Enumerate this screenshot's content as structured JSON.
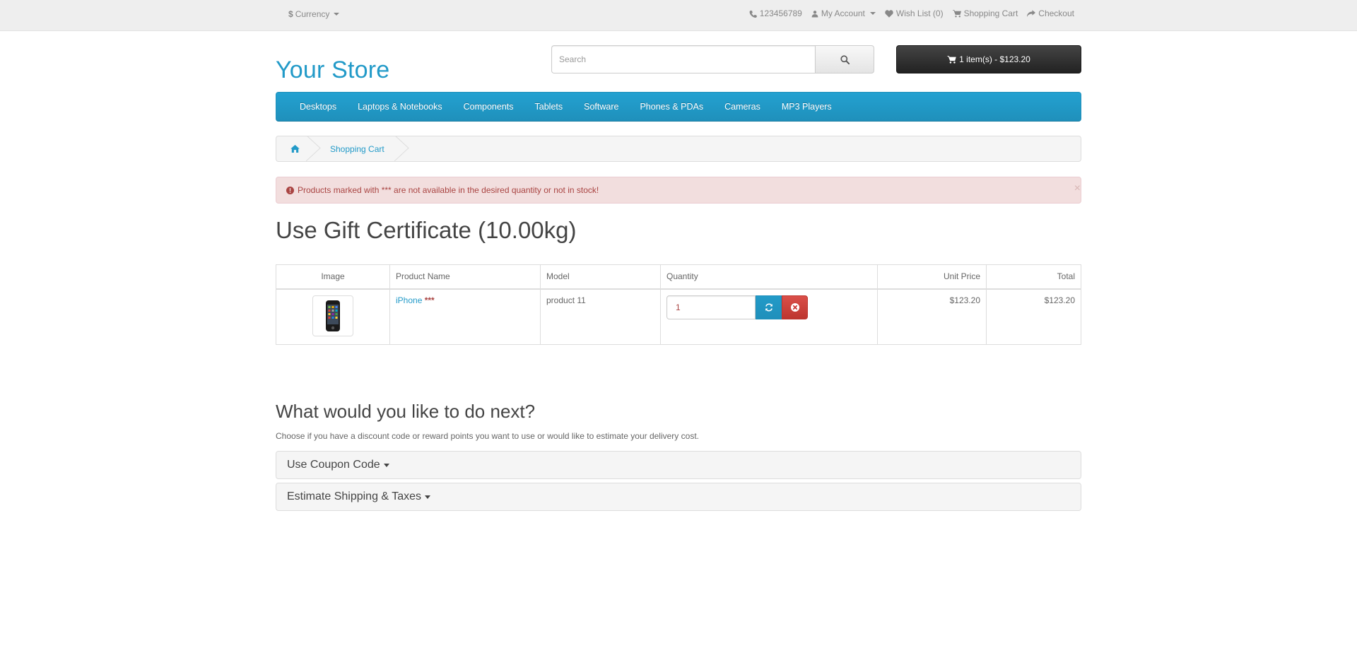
{
  "topbar": {
    "currency_label": "Currency",
    "phone": "123456789",
    "my_account": "My Account",
    "wishlist": "Wish List (0)",
    "shopping_cart": "Shopping Cart",
    "checkout": "Checkout"
  },
  "header": {
    "logo": "Your Store",
    "search_placeholder": "Search",
    "cart_button": "1 item(s) - $123.20"
  },
  "menu": [
    "Desktops",
    "Laptops & Notebooks",
    "Components",
    "Tablets",
    "Software",
    "Phones & PDAs",
    "Cameras",
    "MP3 Players"
  ],
  "breadcrumb": {
    "current": "Shopping Cart"
  },
  "alert": {
    "message": "Products marked with *** are not available in the desired quantity or not in stock!",
    "close": "×"
  },
  "page": {
    "title": "Use Gift Certificate  (10.00kg)"
  },
  "table": {
    "headers": [
      "Image",
      "Product Name",
      "Model",
      "Quantity",
      "Unit Price",
      "Total"
    ],
    "rows": [
      {
        "product_name": "iPhone",
        "stock_flag": "***",
        "model": "product 11",
        "quantity": "1",
        "unit_price": "$123.20",
        "total": "$123.20"
      }
    ]
  },
  "next": {
    "heading": "What would you like to do next?",
    "help": "Choose if you have a discount code or reward points you want to use or would like to estimate your delivery cost.",
    "coupon_panel": "Use Coupon Code",
    "shipping_panel": "Estimate Shipping & Taxes"
  },
  "colors": {
    "accent": "#229ac8",
    "alert_bg": "#f2dede",
    "alert_text": "#a94442",
    "cart_button": "#333333",
    "danger": "#da4f49"
  }
}
